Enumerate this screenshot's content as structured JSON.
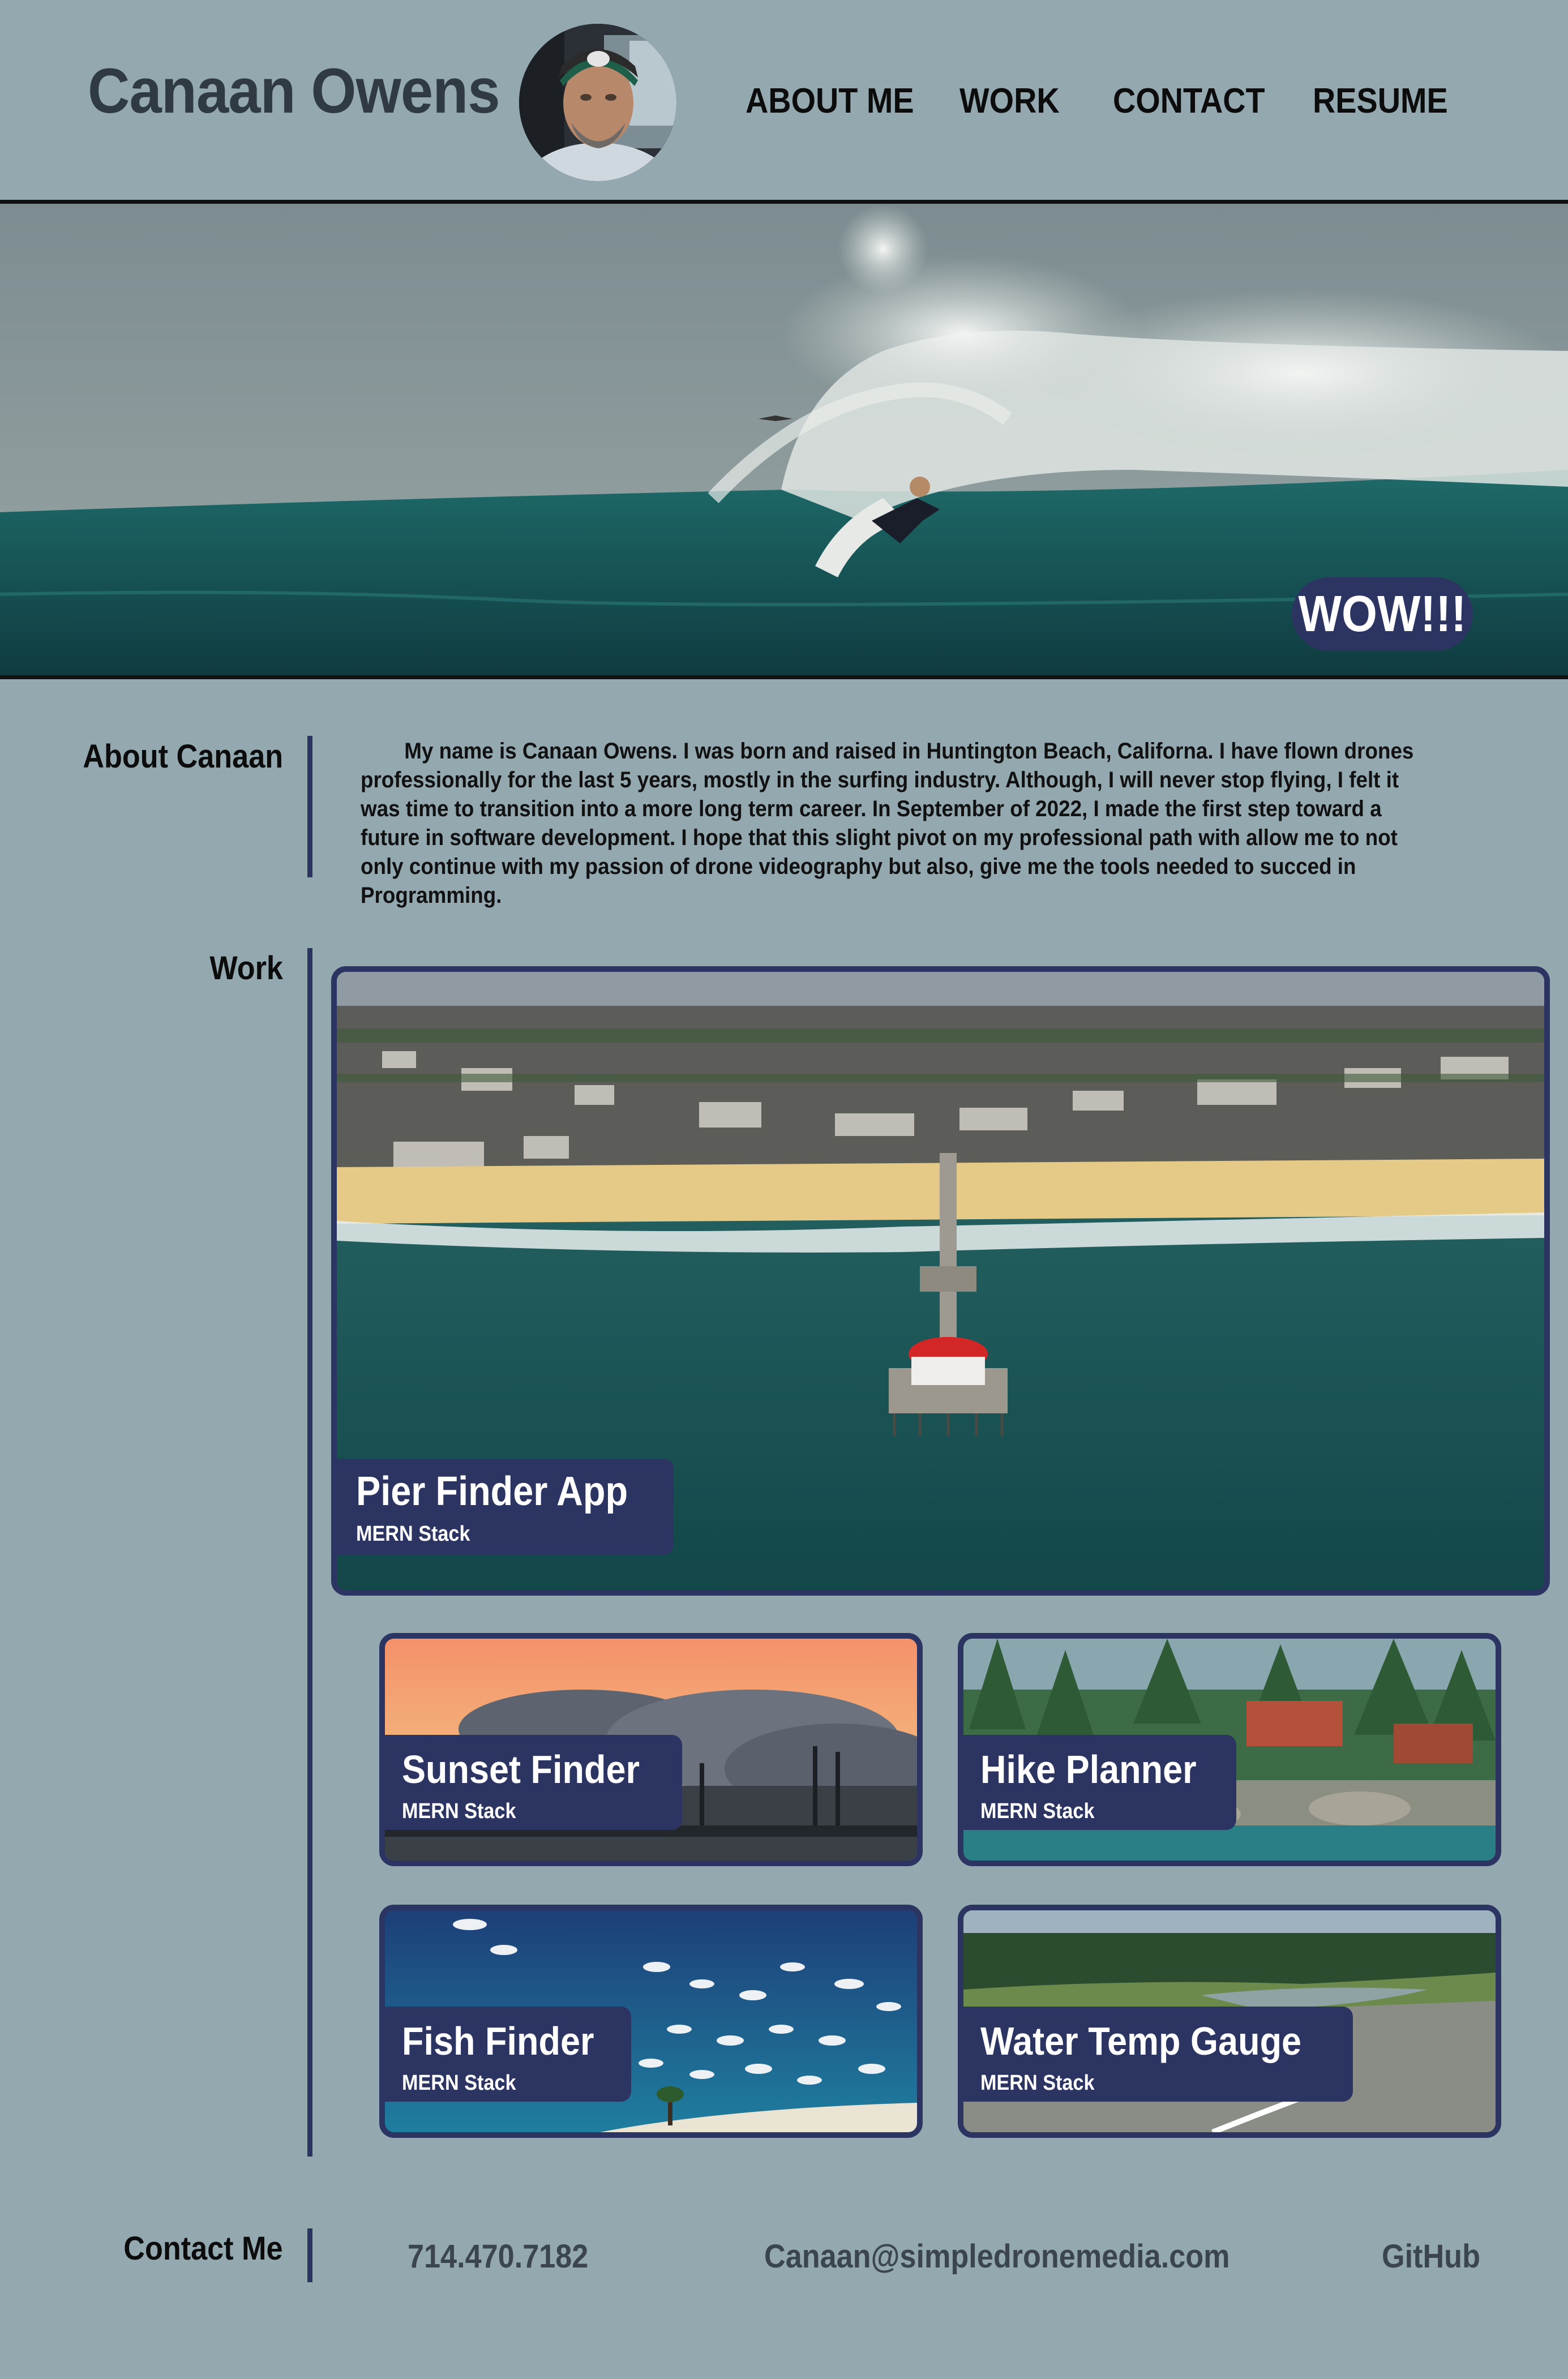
{
  "header": {
    "site_name": "Canaan Owens",
    "nav": {
      "about": "ABOUT ME",
      "work": "WORK",
      "contact": "CONTACT",
      "resume": "RESUME"
    }
  },
  "hero": {
    "badge": "WOW!!!"
  },
  "about": {
    "heading": "About Canaan",
    "text": "My name is Canaan Owens. I was born and raised in Huntington Beach, Californa. I have flown drones professionally for the last 5 years, mostly in the surfing industry. Although, I will never stop flying, I felt it was time to transition into a more long term career. In September of 2022, I made the first step toward a future in software development. I hope that this slight pivot on my professional path with allow me to not only continue with my passion of drone videography but also, give me the tools needed to succed in Programming."
  },
  "work": {
    "heading": "Work",
    "featured": {
      "title": "Pier Finder App",
      "stack": "MERN Stack"
    },
    "projects": [
      {
        "title": "Sunset Finder",
        "stack": "MERN Stack"
      },
      {
        "title": "Hike Planner",
        "stack": "MERN Stack"
      },
      {
        "title": "Fish Finder",
        "stack": "MERN Stack"
      },
      {
        "title": "Water Temp Gauge",
        "stack": "MERN Stack"
      }
    ]
  },
  "contact": {
    "heading": "Contact Me",
    "phone": "714.470.7182",
    "email": "Canaan@simpledronemedia.com",
    "github": "GitHub"
  },
  "colors": {
    "background": "#94a8b0",
    "accent": "#2c3462",
    "divider": "#111111"
  }
}
